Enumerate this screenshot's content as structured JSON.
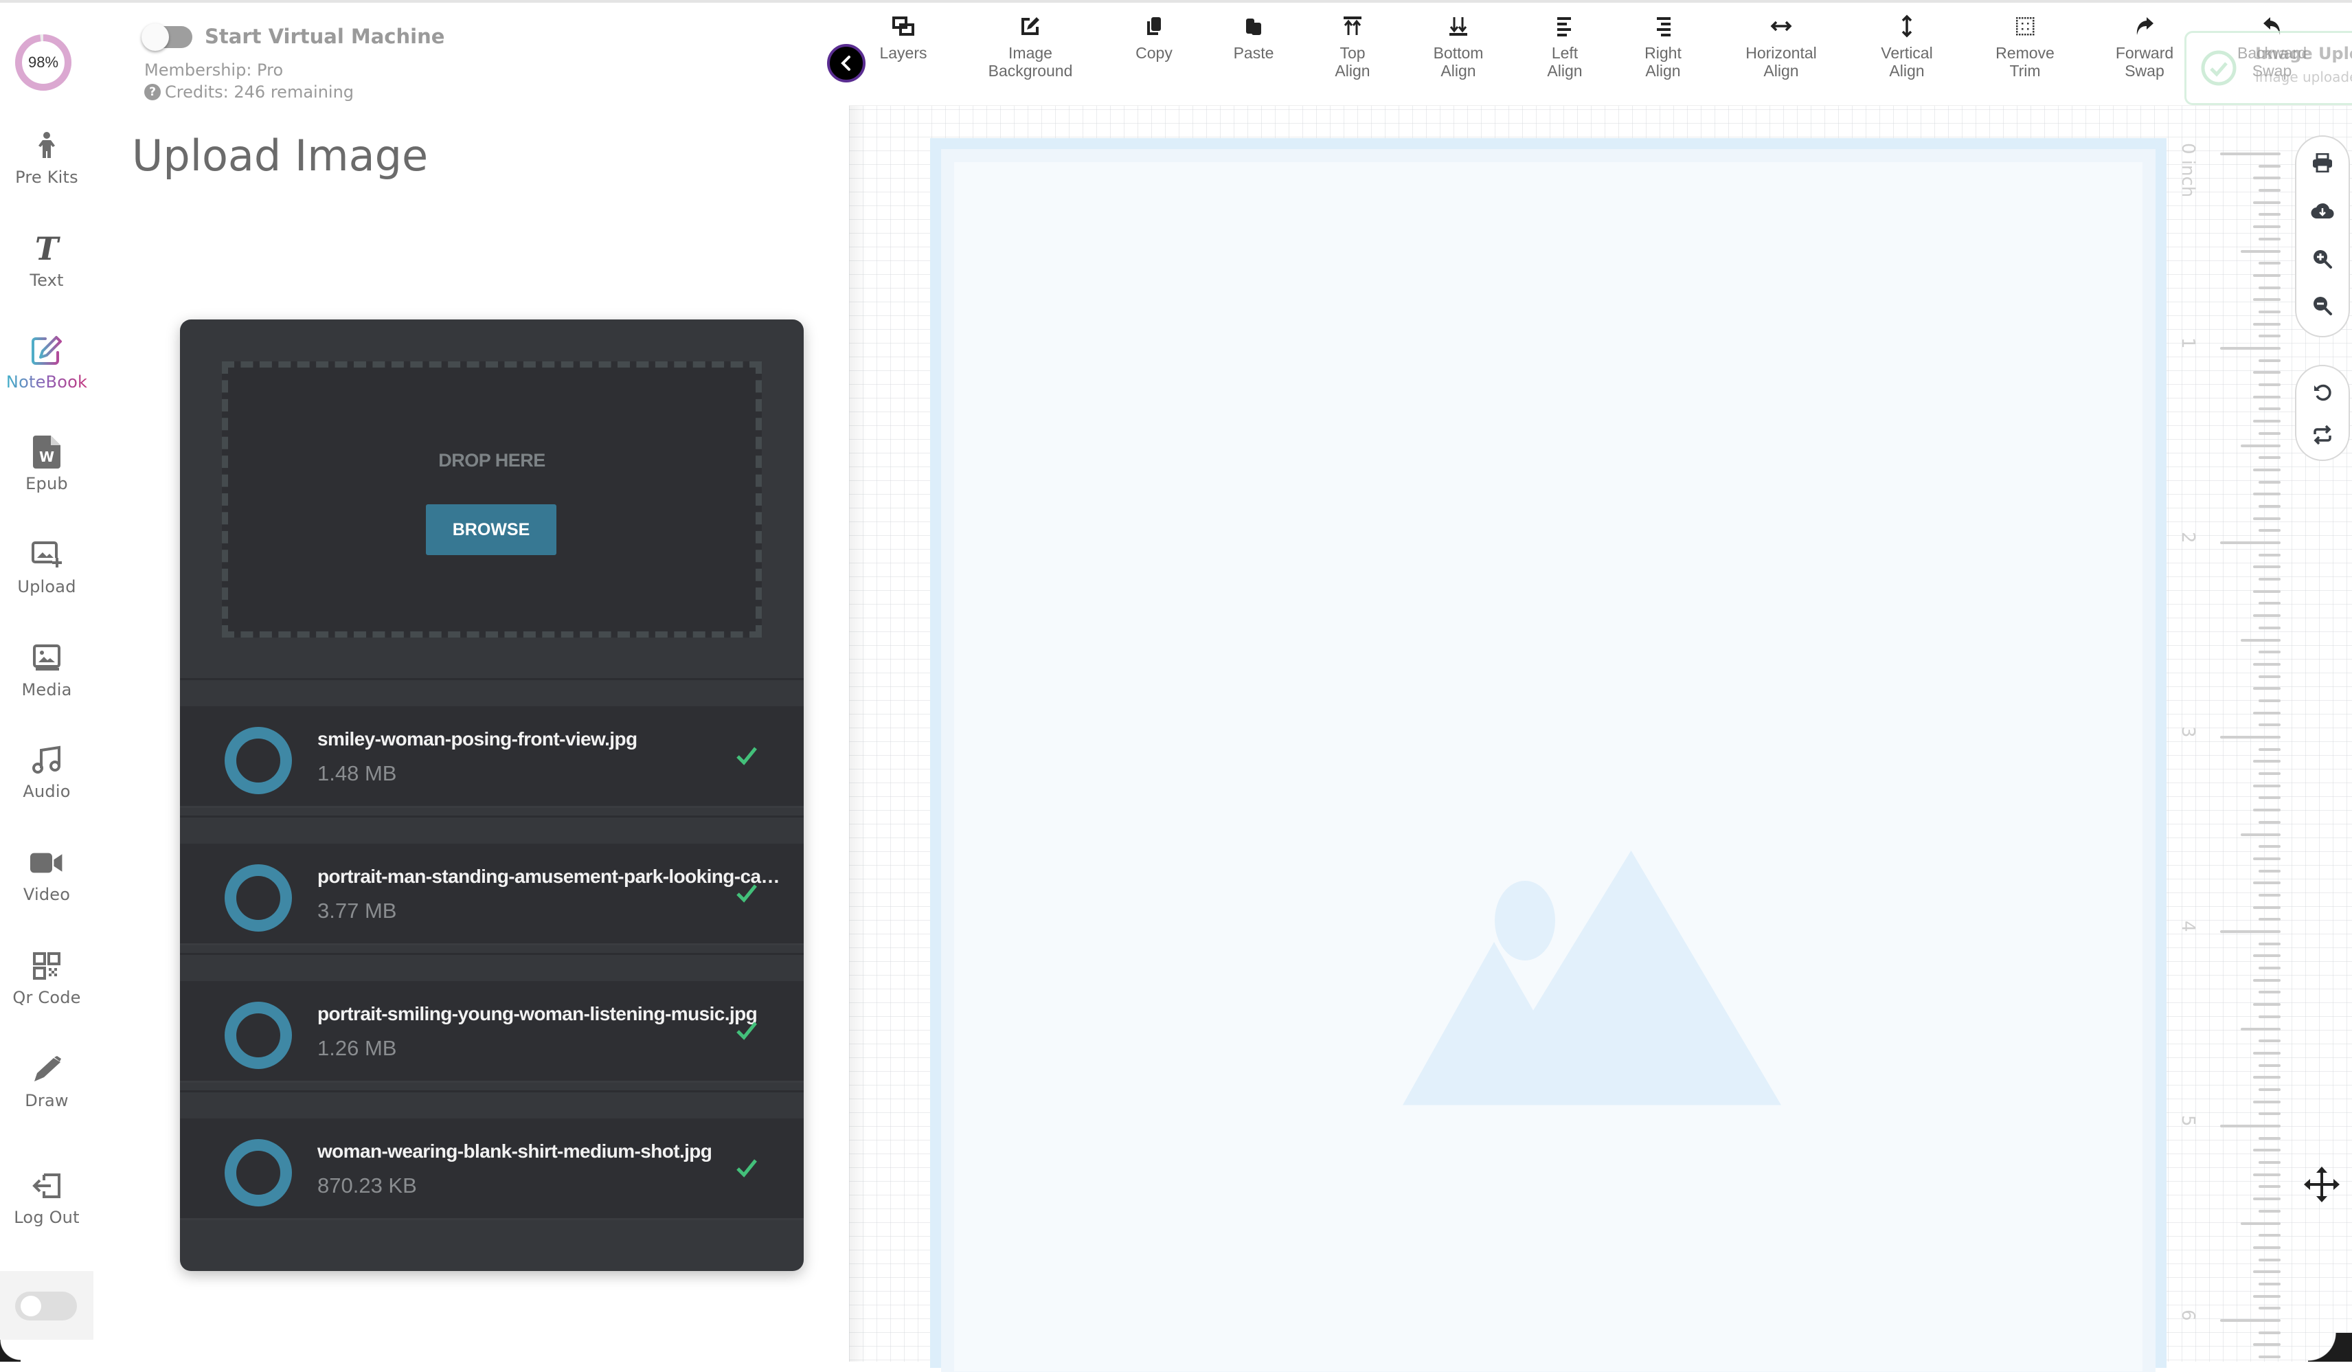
{
  "usage": {
    "percent_label": "98%",
    "percent": 98,
    "ring_color": "#dba8d1"
  },
  "account": {
    "vm_toggle_label": "Start Virtual Machine",
    "vm_on": false,
    "membership": "Membership: Pro",
    "credits": "Credits: 246 remaining",
    "help_glyph": "?"
  },
  "page": {
    "title": "Upload Image"
  },
  "nav": {
    "items": [
      {
        "label": "Pre Kits",
        "icon": "person-icon"
      },
      {
        "label": "Text",
        "icon": "text-icon"
      },
      {
        "label": "NoteBook",
        "icon": "notebook-pen-icon",
        "active": true
      },
      {
        "label": "Epub",
        "icon": "epub-word-icon"
      },
      {
        "label": "Upload",
        "icon": "upload-image-icon"
      },
      {
        "label": "Media",
        "icon": "media-image-icon"
      },
      {
        "label": "Audio",
        "icon": "music-note-icon"
      },
      {
        "label": "Video",
        "icon": "video-camera-icon"
      },
      {
        "label": "Qr Code",
        "icon": "qr-code-icon"
      },
      {
        "label": "Draw",
        "icon": "pencil-icon"
      },
      {
        "label": "Log Out",
        "icon": "logout-icon"
      }
    ],
    "theme_toggle_on": false
  },
  "uploader": {
    "drop_text": "DROP HERE",
    "browse_label": "BROWSE",
    "accent": "#377893",
    "files": [
      {
        "name": "smiley-woman-posing-front-view.jpg",
        "size": "1.48 MB",
        "status": "done"
      },
      {
        "name": "portrait-man-standing-amusement-park-looking-camera.jpg",
        "size": "3.77 MB",
        "status": "done"
      },
      {
        "name": "portrait-smiling-young-woman-listening-music.jpg",
        "size": "1.26 MB",
        "status": "done"
      },
      {
        "name": "woman-wearing-blank-shirt-medium-shot.jpg",
        "size": "870.23 KB",
        "status": "done"
      }
    ]
  },
  "toolbar": {
    "tools": [
      {
        "label": "Layers",
        "icon": "layers-icon"
      },
      {
        "label": "Image\nBackground",
        "icon": "edit-square-icon"
      },
      {
        "label": "Copy",
        "icon": "copy-icon"
      },
      {
        "label": "Paste",
        "icon": "paste-icon"
      },
      {
        "label": "Top\nAlign",
        "icon": "align-top-icon"
      },
      {
        "label": "Bottom\nAlign",
        "icon": "align-bottom-icon"
      },
      {
        "label": "Left\nAlign",
        "icon": "align-left-icon"
      },
      {
        "label": "Right\nAlign",
        "icon": "align-right-icon"
      },
      {
        "label": "Horizontal\nAlign",
        "icon": "horizontal-arrows-icon"
      },
      {
        "label": "Vertical\nAlign",
        "icon": "vertical-arrows-icon"
      },
      {
        "label": "Remove\nTrim",
        "icon": "dotted-square-icon"
      },
      {
        "label": "Forward\nSwap",
        "icon": "redo-arrow-icon"
      },
      {
        "label": "Backward\nSwap",
        "icon": "undo-arrow-icon"
      }
    ]
  },
  "toast": {
    "title": "Image Uploaded",
    "message": "Image uploaded",
    "color": "#cdebd6"
  },
  "ruler": {
    "unit": "inch",
    "labels": [
      "0",
      "1",
      "2",
      "3",
      "4",
      "5",
      "6"
    ]
  },
  "side_tools": {
    "group1": [
      "print-icon",
      "cloud-download-icon",
      "zoom-in-icon",
      "zoom-out-icon"
    ],
    "group2": [
      "rotate-left-icon",
      "repeat-icon"
    ]
  }
}
